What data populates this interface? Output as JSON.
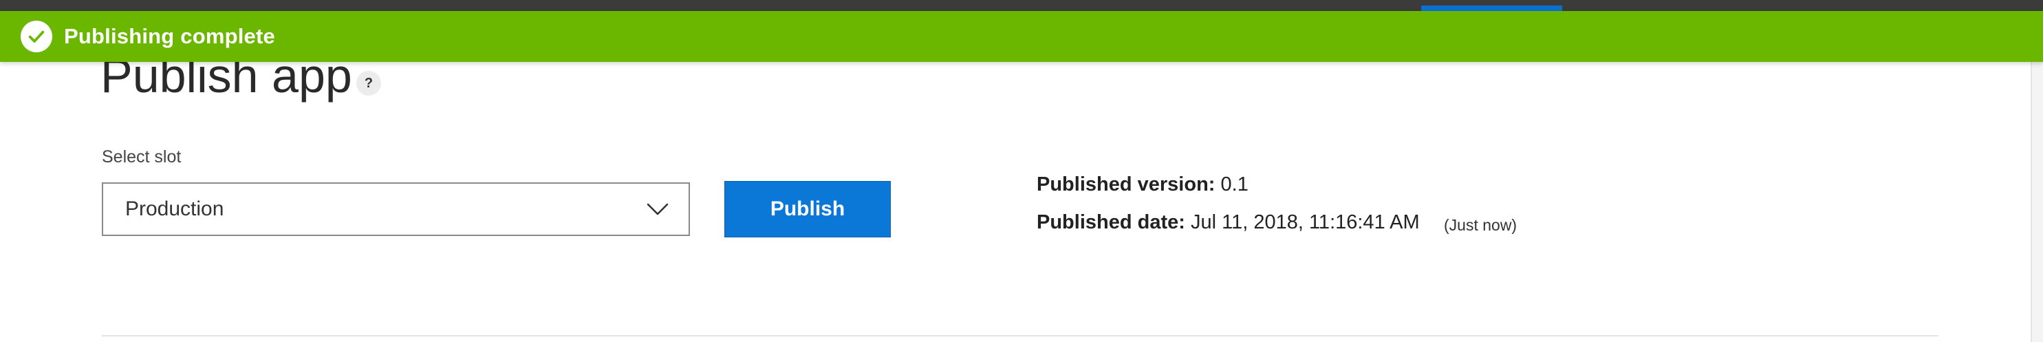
{
  "toast": {
    "message": "Publishing complete",
    "icon": "check-circle-icon",
    "color": "#6bb700"
  },
  "header": {
    "title": "Publish app",
    "help_icon": "?"
  },
  "slot": {
    "label": "Select slot",
    "selected": "Production"
  },
  "actions": {
    "publish_label": "Publish",
    "publish_color": "#0b78d7"
  },
  "published": {
    "version_label": "Published version:",
    "version_value": "0.1",
    "date_label": "Published date:",
    "date_value": "Jul 11, 2018, 11:16:41 AM",
    "relative": "(Just now)"
  }
}
